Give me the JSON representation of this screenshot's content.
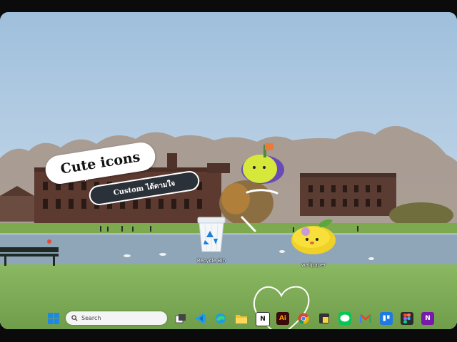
{
  "desktop": {
    "icons": [
      {
        "label": "Recycle Bin"
      },
      {
        "label": "wallpaper"
      }
    ],
    "sticker_title": "Cute icons",
    "sticker_subtitle": "Custom ได้ตามใจ",
    "sticker_star": "*"
  },
  "taskbar": {
    "search_placeholder": "Search",
    "apps": [
      {
        "name": "start-icon"
      },
      {
        "name": "task-view-icon"
      },
      {
        "name": "vscode-icon"
      },
      {
        "name": "edge-icon"
      },
      {
        "name": "file-explorer-icon"
      },
      {
        "name": "notion-icon",
        "text": "N"
      },
      {
        "name": "illustrator-icon",
        "text": "Ai"
      },
      {
        "name": "chrome-icon"
      },
      {
        "name": "sticky-notes-icon"
      },
      {
        "name": "line-icon"
      },
      {
        "name": "gmail-icon"
      },
      {
        "name": "trello-icon"
      },
      {
        "name": "figma-icon"
      },
      {
        "name": "onenote-icon",
        "text": "N"
      }
    ]
  },
  "colors": {
    "sky": "#b9d0e6",
    "grass": "#7fae55",
    "lake": "#8fa6b8",
    "illustrator": "#3b0a0a",
    "line": "#06c755",
    "trello": "#1f7ae0",
    "onenote": "#7719aa"
  }
}
